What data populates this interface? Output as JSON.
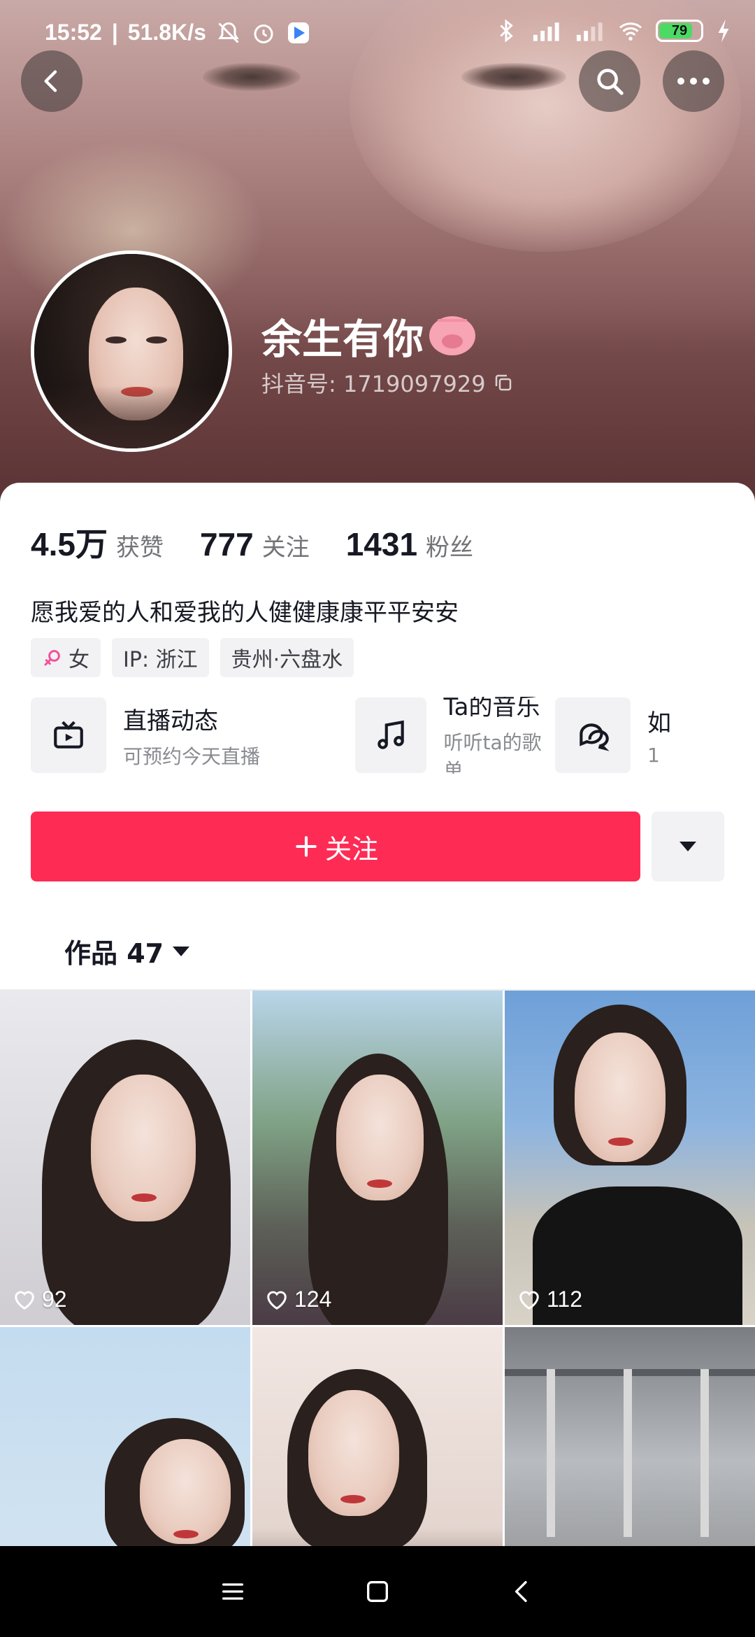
{
  "status_bar": {
    "time": "15:52",
    "net_speed": "51.8K/s",
    "battery": "79",
    "icons": [
      "mute-bell-icon",
      "alarm-icon",
      "app-icon",
      "bluetooth-icon",
      "signal-hd-icon",
      "signal-hd-icon",
      "wifi-icon",
      "battery-icon",
      "charging-icon"
    ]
  },
  "header": {
    "back_icon": "chevron-left-icon",
    "search_icon": "search-icon",
    "more_icon": "more-horizontal-icon"
  },
  "profile": {
    "name": "余生有你",
    "name_emoji": "pig-face-icon",
    "douyin_id": "抖音号: 1719097929",
    "copy_icon": "copy-icon"
  },
  "stats": [
    {
      "value": "4.5万",
      "label": "获赞"
    },
    {
      "value": "777",
      "label": "关注"
    },
    {
      "value": "1431",
      "label": "粉丝"
    }
  ],
  "bio": "愿我爱的人和爱我的人健健康康平平安安",
  "tags": [
    {
      "label": "女",
      "icon": "female-icon"
    },
    {
      "label": "IP: 浙江"
    },
    {
      "label": "贵州·六盘水"
    }
  ],
  "features": [
    {
      "title": "直播动态",
      "subtitle": "可预约今天直播",
      "icon": "tv-icon"
    },
    {
      "title": "Ta的音乐",
      "subtitle": "听听ta的歌单",
      "icon": "music-note-icon"
    },
    {
      "title": "如",
      "subtitle": "1",
      "icon": "chat-bubbles-icon"
    }
  ],
  "actions": {
    "follow_label": "关注",
    "follow_icon": "plus-icon",
    "more_icon": "triangle-down-icon"
  },
  "works": {
    "tab_label": "作品 47",
    "tab_icon": "triangle-down-icon"
  },
  "videos": [
    {
      "likes": "92"
    },
    {
      "likes": "124"
    },
    {
      "likes": "112"
    },
    {
      "likes": ""
    },
    {
      "likes": ""
    },
    {
      "likes": ""
    }
  ],
  "system_nav": {
    "icons": [
      "menu-icon",
      "home-square-icon",
      "back-icon"
    ]
  },
  "colors": {
    "accent": "#fe2c55",
    "text_primary": "#161823",
    "text_secondary": "#737478",
    "tag_bg": "#f2f2f4"
  }
}
